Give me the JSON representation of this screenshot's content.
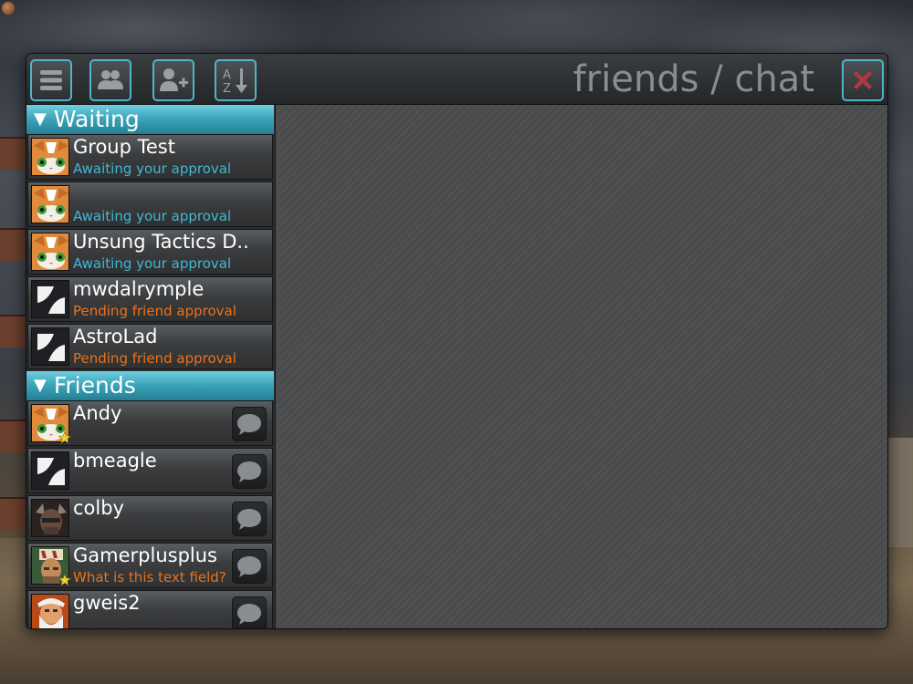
{
  "window": {
    "title": "friends / chat"
  },
  "toolbar": {
    "menu_icon": "menu-icon",
    "friends_icon": "friends-icon",
    "add_friend_icon": "add-friend-icon",
    "sort_icon": "sort-az-icon",
    "close_icon": "close-icon"
  },
  "colors": {
    "accent": "#4fb6c9",
    "awaiting": "#40b8d4",
    "pending": "#e8731e",
    "close": "#b03a3a"
  },
  "sections": {
    "waiting": {
      "header": "Waiting",
      "items": [
        {
          "name": "Group Test",
          "status": "Awaiting your approval",
          "avatar": "cat-avatar"
        },
        {
          "name": "",
          "status": "Awaiting your approval",
          "avatar": "cat-avatar"
        },
        {
          "name": "Unsung Tactics D..",
          "status": "Awaiting your approval",
          "avatar": "cat-avatar"
        },
        {
          "name": "mwdalrymple",
          "status": "Pending friend approval",
          "avatar": "default-avatar"
        },
        {
          "name": "AstroLad",
          "status": "Pending friend approval",
          "avatar": "default-avatar"
        }
      ]
    },
    "friends": {
      "header": "Friends",
      "items": [
        {
          "name": "Andy",
          "status": "",
          "avatar": "cat-avatar",
          "badge": "star-icon"
        },
        {
          "name": "bmeagle",
          "status": "",
          "avatar": "default-avatar"
        },
        {
          "name": "colby",
          "status": "",
          "avatar": "warrior-avatar"
        },
        {
          "name": "Gamerplusplus",
          "status": "What is this text field?",
          "avatar": "soldier-avatar",
          "badge": "star-icon"
        },
        {
          "name": "gweis2",
          "status": "",
          "avatar": "wizard-avatar"
        }
      ]
    }
  }
}
